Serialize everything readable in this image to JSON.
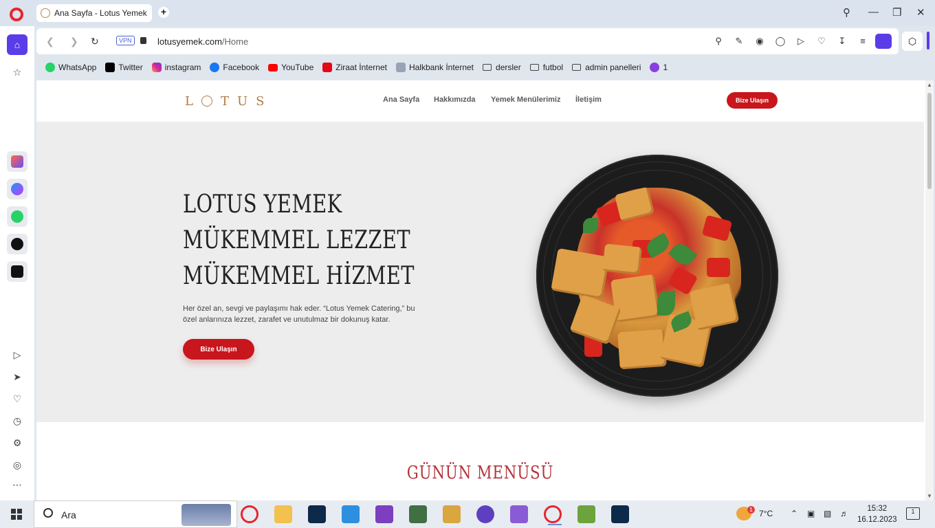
{
  "browser": {
    "tab_title": "Ana Sayfa - Lotus Yemek",
    "new_tab": "+",
    "vpn": "VPN",
    "url_host": "lotusyemek.com",
    "url_path": "/Home"
  },
  "bookmarks": [
    {
      "label": "WhatsApp",
      "color": "#25d366",
      "icon": "whatsapp-icon"
    },
    {
      "label": "Twitter",
      "color": "#000000",
      "icon": "x-icon"
    },
    {
      "label": "instagram",
      "color": "#d6249f",
      "icon": "instagram-icon"
    },
    {
      "label": "Facebook",
      "color": "#1877f2",
      "icon": "facebook-icon"
    },
    {
      "label": "YouTube",
      "color": "#ff0000",
      "icon": "youtube-icon"
    },
    {
      "label": "Ziraat İnternet",
      "color": "#e30a17",
      "icon": "ziraat-icon"
    },
    {
      "label": "Halkbank İnternet",
      "color": "#9aa3b5",
      "icon": "halkbank-icon"
    },
    {
      "label": "dersler",
      "icon": "folder-icon"
    },
    {
      "label": "futbol",
      "icon": "folder-icon"
    },
    {
      "label": "admin panelleri",
      "icon": "folder-icon"
    },
    {
      "label": "1",
      "color": "#8a3ee0",
      "icon": "extension-icon"
    }
  ],
  "site": {
    "logo": "LOTUS",
    "nav": [
      "Ana Sayfa",
      "Hakkımızda",
      "Yemek Menülerimiz",
      "İletişim"
    ],
    "header_button": "Bize Ulaşın",
    "hero": {
      "line1": "LOTUS YEMEK",
      "line2": "MÜKEMMEL LEZZET",
      "line3": "MÜKEMMEL HİZMET",
      "description": "Her özel an, sevgi ve paylaşımı hak eder. “Lotus Yemek Catering,” bu özel anlarınıza lezzet, zarafet ve unutulmaz bir dokunuş katar.",
      "button": "Bize Ulaşın"
    },
    "section_title": "GÜNÜN MENÜSÜ"
  },
  "taskbar": {
    "search": "Ara",
    "weather": "7°C",
    "weather_badge": "1",
    "time": "15:32",
    "date": "16.12.2023",
    "notifications": "1"
  },
  "colors": {
    "accent": "#c8161d",
    "logo": "#b07a45",
    "opera": "#5a3ce8"
  }
}
